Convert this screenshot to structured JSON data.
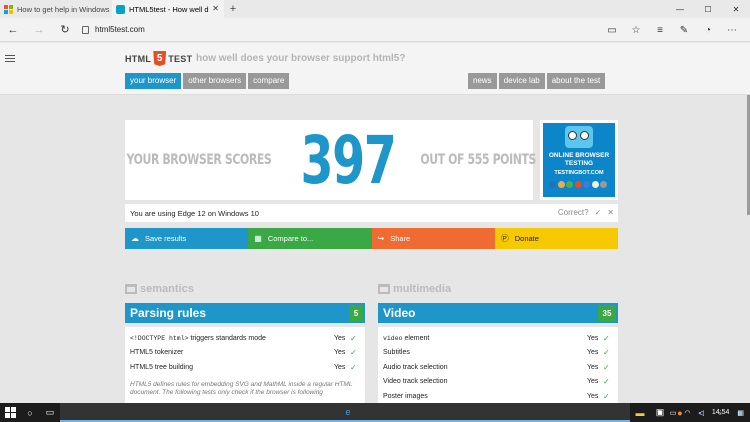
{
  "browser": {
    "tabs": [
      {
        "title": "How to get help in Windows",
        "active": false
      },
      {
        "title": "HTML5test - How well d",
        "active": true
      }
    ],
    "new_tab": "+",
    "url": "html5test.com",
    "window_controls": {
      "minimize": "—",
      "maximize": "☐",
      "close": "✕"
    }
  },
  "site": {
    "logo_left": "HTML",
    "logo_num": "5",
    "logo_right": "TEST",
    "tagline": "how well does your browser support html5?",
    "nav_left": [
      "your browser",
      "other browsers",
      "compare"
    ],
    "nav_right": [
      "news",
      "device lab",
      "about the test"
    ],
    "score_prefix": "YOUR BROWSER SCORES",
    "score": "397",
    "score_suffix": "OUT OF 555 POINTS",
    "ad": {
      "line1": "ONLINE BROWSER",
      "line2": "TESTING",
      "line3": "TESTINGBOT.COM"
    },
    "using_text": "You are using Edge 12 on Windows 10",
    "correct_label": "Correct?",
    "actions": [
      "Save results",
      "Compare to...",
      "Share",
      "Donate"
    ]
  },
  "sections": {
    "semantics": {
      "heading": "semantics",
      "category": "Parsing rules",
      "score": "5",
      "rows": [
        {
          "code": "<!DOCTYPE html>",
          "label": " triggers standards mode",
          "result": "Yes"
        },
        {
          "code": "",
          "label": "HTML5 tokenizer",
          "result": "Yes"
        },
        {
          "code": "",
          "label": "HTML5 tree building",
          "result": "Yes"
        }
      ],
      "note": "HTML5 defines rules for embedding SVG and MathML inside a regular HTML document. The following tests only check if the browser is following"
    },
    "multimedia": {
      "heading": "multimedia",
      "category": "Video",
      "score": "35",
      "rows": [
        {
          "code": "video",
          "label": " element",
          "result": "Yes"
        },
        {
          "code": "",
          "label": "Subtitles",
          "result": "Yes"
        },
        {
          "code": "",
          "label": "Audio track selection",
          "result": "Yes"
        },
        {
          "code": "",
          "label": "Video track selection",
          "result": "Yes"
        },
        {
          "code": "",
          "label": "Poster images",
          "result": "Yes"
        }
      ]
    }
  },
  "taskbar": {
    "time": "14:54"
  },
  "colors": {
    "accent": "#1f96c9",
    "green": "#39a845",
    "orange": "#f06b32",
    "yellow": "#f7c900"
  }
}
